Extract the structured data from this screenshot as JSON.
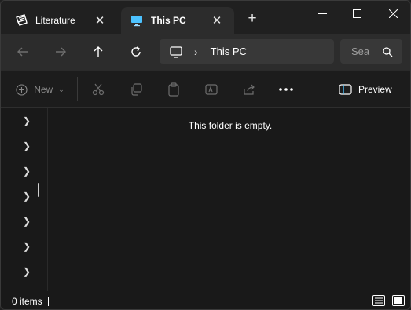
{
  "tabs": [
    {
      "label": "Literature",
      "icon": "folder-app-icon",
      "active": false
    },
    {
      "label": "This PC",
      "icon": "monitor-icon",
      "active": true
    }
  ],
  "window_controls": {
    "minimize": "minimize-icon",
    "maximize": "maximize-icon",
    "close": "close-icon"
  },
  "address": {
    "crumb": "This PC",
    "search_placeholder": "Sea"
  },
  "commands": {
    "new_label": "New",
    "preview_label": "Preview"
  },
  "content": {
    "empty_message": "This folder is empty."
  },
  "status": {
    "item_count": "0 items"
  },
  "colors": {
    "accent": "#4cc2ff",
    "background": "#191919",
    "chrome": "#2c2c2c"
  }
}
